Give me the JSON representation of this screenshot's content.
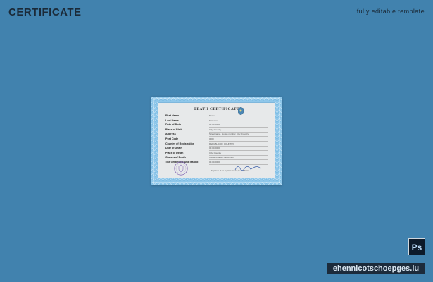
{
  "header": {
    "title": "CERTIFICATE",
    "tagline": "fully editable template"
  },
  "certificate": {
    "heading": "DEATH CERTIFICATE",
    "rows": [
      {
        "label": "First Name",
        "value": "Name"
      },
      {
        "label": "Last Name",
        "value": "Surname"
      },
      {
        "label": "Date of Birth",
        "value": "00.00.0000"
      },
      {
        "label": "Place of Birth",
        "value": "City, Country"
      },
      {
        "label": "Address",
        "value": "Street name, House number, City, Country"
      },
      {
        "label": "Post Code",
        "value": "0000"
      },
      {
        "label": "Country of Registration",
        "value": "REPUBLIC OF COUNTRY"
      },
      {
        "label": "Date of Death",
        "value": "00.00.0000"
      },
      {
        "label": "Place of Death",
        "value": "City, Country"
      },
      {
        "label": "Causes of Death",
        "value": "Cause of death description"
      },
      {
        "label": "The Certificate was Issued",
        "value": "00.00.0000"
      }
    ],
    "signature_caption": "Signature of the registrar issuing the certificate"
  },
  "badges": {
    "photoshop": "Ps",
    "watermark": "ehennicotschoepges.lu"
  },
  "colors": {
    "background": "#4182ae",
    "frame": "#8fc7ea",
    "paper": "#e7e9ea",
    "title_text": "#1b2a38"
  }
}
